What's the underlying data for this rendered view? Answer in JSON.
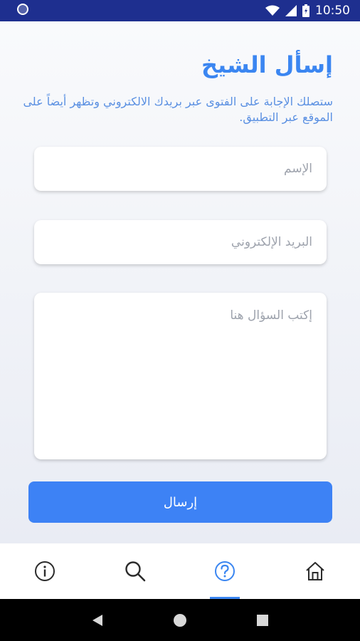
{
  "status_bar": {
    "time": "10:50",
    "icons": [
      "notification-dot-icon",
      "wifi-icon",
      "signal-icon",
      "battery-icon"
    ]
  },
  "page": {
    "title": "إسأل الشيخ",
    "subtitle": "ستصلك الإجابة على الفتوى عبر بريدك الالكتروني وتظهر أيضاً على الموقع عبر التطبيق.",
    "name_placeholder": "الإسم",
    "email_placeholder": "البريد الإلكتروني",
    "question_placeholder": "إكتب السؤال هنا",
    "submit_label": "إرسال"
  },
  "bottom_nav": {
    "items": [
      {
        "icon": "info-icon",
        "active": false
      },
      {
        "icon": "search-icon",
        "active": false
      },
      {
        "icon": "question-icon",
        "active": true
      },
      {
        "icon": "home-icon",
        "active": false
      }
    ]
  },
  "android_nav": {
    "icons": [
      "back-icon",
      "home-circle-icon",
      "recents-icon"
    ]
  },
  "colors": {
    "status_bar": "#1e2f8f",
    "accent": "#3b86f1",
    "button": "#3d82f5",
    "nav_icon": "#2b2b2b"
  }
}
